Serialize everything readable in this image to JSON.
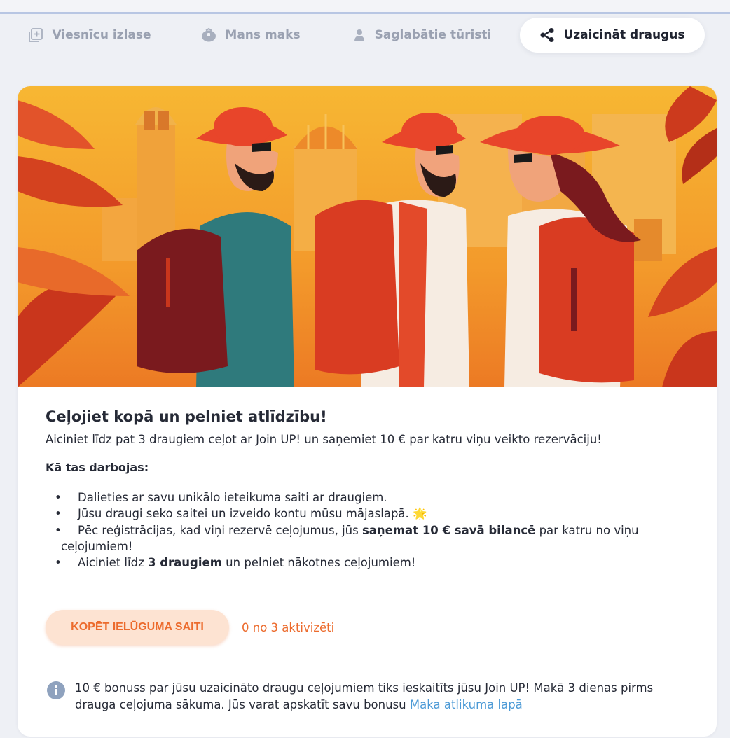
{
  "tabs": [
    {
      "label": "Viesnīcu izlase",
      "icon": "plus-square-icon",
      "active": false
    },
    {
      "label": "Mans maks",
      "icon": "wallet-icon",
      "active": false
    },
    {
      "label": "Saglabātie tūristi",
      "icon": "user-icon",
      "active": false
    },
    {
      "label": "Uzaicināt draugus",
      "icon": "share-icon",
      "active": true
    }
  ],
  "referral": {
    "title": "Ceļojiet kopā un pelniet atlīdzību!",
    "subtitle": "Aiciniet līdz pat 3 draugiem ceļot ar Join UP! un saņemiet 10 € par katru viņu veikto rezervāciju!",
    "how_title": "Kā tas darbojas:",
    "bullet1": "Dalieties ar savu unikālo ieteikuma saiti ar draugiem.",
    "bullet2": "Jūsu draugi seko saitei un izveido kontu mūsu mājaslapā.",
    "bullet2_emoji": "🌟",
    "bullet3_pre": "Pēc reģistrācijas, kad viņi rezervē ceļojumus, jūs",
    "bullet3_bold": "saņemat 10 € savā bilancē",
    "bullet3_post": "par katru no viņu",
    "bullet3_cont": "ceļojumiem!",
    "bullet4_pre": "Aiciniet līdz",
    "bullet4_bold": "3 draugiem",
    "bullet4_post": "un pelniet nākotnes ceļojumiem!",
    "copy_button": "KOPĒT IELŪGUMA SAITI",
    "activated": "0 no 3 aktivizēti",
    "info_line1": "10 € bonuss par jūsu uzaicināto draugu ceļojumiem tiks ieskaitīts jūsu Join UP! Makā 3 dienas pirms",
    "info_line2": "drauga ceļojuma sākuma. Jūs varat apskatīt savu bonusu",
    "info_link": "Maka atlikuma lapā"
  },
  "colors": {
    "accent": "#ec6b2d",
    "button_bg": "#fde3d2",
    "link": "#4c9ad6",
    "inactive_tab": "#9aa1b1",
    "background": "#eef0f5"
  }
}
